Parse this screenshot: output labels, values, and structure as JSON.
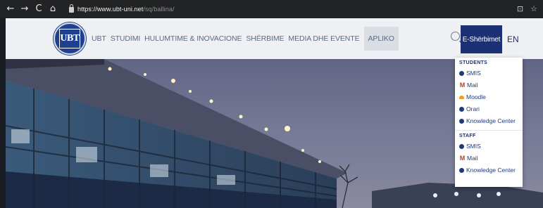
{
  "browser": {
    "back_icon": "←",
    "forward_icon": "→",
    "reload_icon": "C",
    "home_icon": "⌂",
    "url_host": "https://www.ubt-uni.net",
    "url_path": "/sq/ballina/",
    "right_icon_1": "⊡",
    "right_icon_2": "☆"
  },
  "header": {
    "logo_text": "UBT",
    "menu": [
      "UBT",
      "STUDIMI",
      "HULUMTIME & INOVACIONE",
      "SHËRBIME",
      "MEDIA DHE EVENTE",
      "APLIKO"
    ],
    "eservices_label": "E-Shërbimet",
    "language": "EN"
  },
  "dropdown": {
    "students_heading": "STUDENTS",
    "students": [
      {
        "label": "SMIS",
        "icon": "smis-icon"
      },
      {
        "label": "Mail",
        "icon": "gmail-icon"
      },
      {
        "label": "Moodle",
        "icon": "moodle-icon"
      },
      {
        "label": "Orari",
        "icon": "orari-icon"
      },
      {
        "label": "Knowledge Center",
        "icon": "knowledge-center-icon"
      }
    ],
    "staff_heading": "STAFF",
    "staff": [
      {
        "label": "SMIS",
        "icon": "smis-icon"
      },
      {
        "label": "Mail",
        "icon": "gmail-icon"
      },
      {
        "label": "Knowledge Center",
        "icon": "knowledge-center-icon"
      }
    ]
  },
  "colors": {
    "navy": "#1c3174",
    "menu_text": "#5a6a86",
    "chrome_bg": "#222325"
  }
}
